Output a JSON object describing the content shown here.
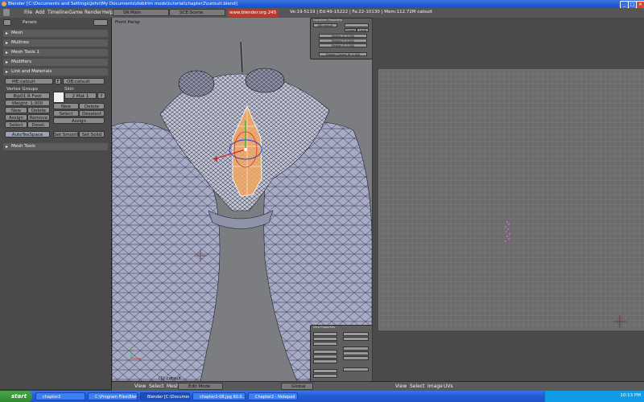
{
  "window": {
    "title": "Blender [C:\\Documents and Settings\\John\\My Documents\\doblrim mods\\tutorial\\chapter2\\catsuit.blend]"
  },
  "menubar": {
    "items": [
      "File",
      "Add",
      "Timeline",
      "Game",
      "Render",
      "Help"
    ],
    "screen": "SR:Main",
    "scene": "SCE:Scene",
    "url": "www.blender.org 245",
    "stats": "Ve:19-5119 | Ed:49-15222 | Fa:22-10130 | Mem:112.72M catsuit"
  },
  "panel": {
    "header_label": "Panels",
    "sections": [
      "Mesh",
      "Multires",
      "Mesh Tools 1",
      "Modifiers",
      "Link and Materials",
      "Mesh Tools"
    ],
    "link": {
      "mesh_name": "ME:catsuit",
      "f_label": "F",
      "object_name": "OB:catsuit"
    },
    "vertex_groups": {
      "title": "Vertex Groups",
      "group": "Bip01 R Foot",
      "weight": "Weight: 1.000",
      "new": "New",
      "delete": "Delete",
      "assign": "Assign",
      "remove": "Remove",
      "select": "Select",
      "deselect": "Desel."
    },
    "material": {
      "title": "Skin",
      "mat_index": "2 Mat 1",
      "new": "New",
      "delete": "Delete",
      "select": "Select",
      "deselect": "Deselect",
      "assign": "Assign"
    },
    "auto_tex": "AutoTexSpace",
    "set_smooth": "Set Smooth",
    "set_solid": "Set Solid"
  },
  "viewport": {
    "label": "Front Persp",
    "transform": {
      "title": "Transform Properties",
      "name": "ME:catsuit",
      "vert_x": "Median X: 0.000",
      "vert_y": "Median Y: 0.000",
      "vert_z": "Median Z: 0.000",
      "global": "Global",
      "local": "Local",
      "crease": "Median Crease W: 0.000"
    },
    "view_props": {
      "title": "View Properties"
    },
    "object_label": "(1) catsuit"
  },
  "bottombar": {
    "items": [
      "View",
      "Select",
      "Mesh"
    ],
    "mode": "Edit Mode",
    "orientation": "Global"
  },
  "rightbar": {
    "items": [
      "View",
      "Select",
      "Image",
      "UVs"
    ]
  },
  "taskbar": {
    "start": "start",
    "tasks": [
      "chapter2",
      "C:\\Program Files\\Blen...",
      "Blender [C:\\Documen...",
      "chapter2-08.jpg 60.0...",
      "Chapter2 - Notepad"
    ],
    "clock": "10:13 PM"
  },
  "colors": {
    "viewport_bg": "#7b7d81",
    "mesh_fill": "#aeb2c9",
    "selection": "#f3a860",
    "taskbar": "#245edb"
  }
}
